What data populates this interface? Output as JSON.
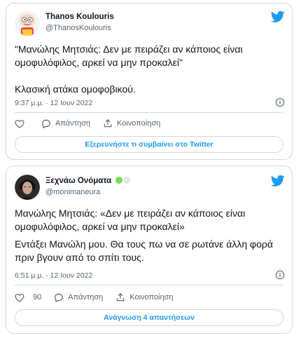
{
  "tweets": [
    {
      "name": "Thanos Koulouris",
      "handle": "@ThanosKoulouris",
      "text_p1": "\"Μανώλης Μητσιάς: Δεν με πειράζει αν κάποιος είναι ομοφυλόφιλος, αρκεί να μην προκαλεί\"",
      "text_p2": "Κλασική ατάκα ομοφοβικού.",
      "time": "9:37 μ.μ. · 12 Ιουν 2022",
      "reply_label": "Απάντηση",
      "share_label": "Κοινοποίηση",
      "cta_label": "Εξερευνήστε τι συμβαίνει στο Twitter"
    },
    {
      "name": "Ξεχνάω Ονόματα",
      "handle": "@monimaneura",
      "text_p1": "Μανώλης Μητσιάς: «Δεν με πειράζει αν κάποιος είναι ομοφυλόφιλος, αρκεί να μην προκαλεί»",
      "text_p2": "Εντάξει Μανώλη μου. Θα τους πω να σε ρωτάνε άλλη φορά πριν βγουν από το σπίτι τους.",
      "time": "6:51 μ.μ. · 12 Ιουν 2022",
      "like_count": "90",
      "reply_label": "Απάντηση",
      "share_label": "Κοινοποίηση",
      "cta_label": "Ανάγνωση 4 απαντήσεων"
    }
  ],
  "colors": {
    "twitter_blue": "#1d9bf0",
    "secondary_text": "#536471",
    "border": "#cfd9de",
    "badge_green": "#7ed957",
    "badge_gray": "#e6e6e6"
  }
}
